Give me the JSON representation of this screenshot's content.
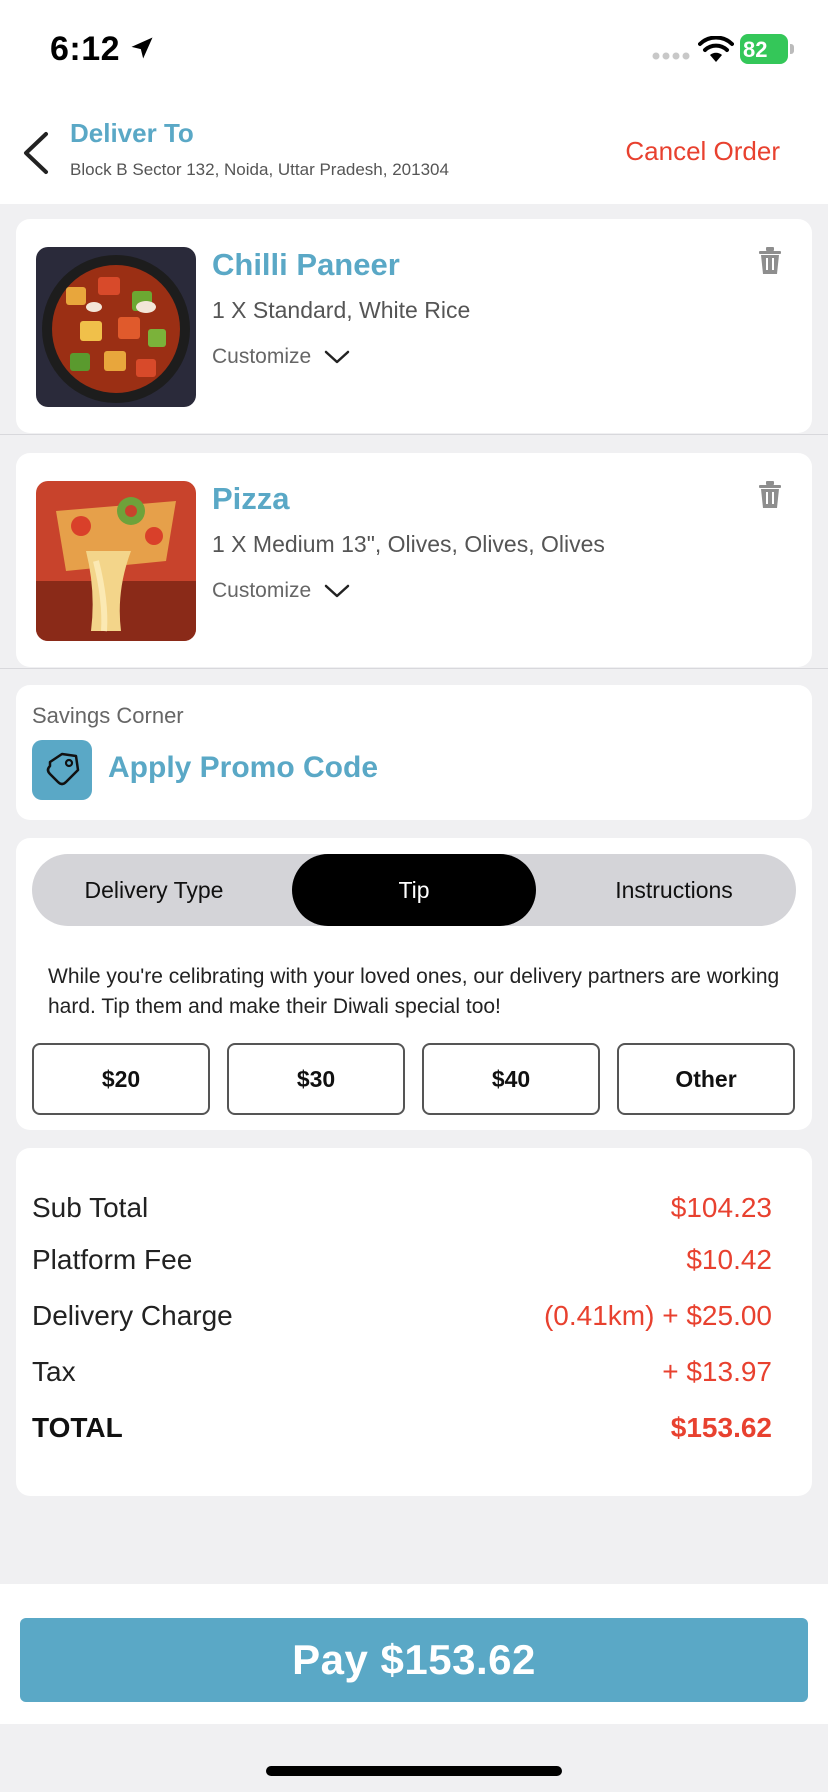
{
  "status_bar": {
    "time": "6:12",
    "battery": "82"
  },
  "header": {
    "title": "Deliver To",
    "address": "Block B Sector 132, Noida, Uttar Pradesh, 201304",
    "cancel_label": "Cancel Order"
  },
  "cart": {
    "items": [
      {
        "name": "Chilli Paneer",
        "details": "1 X Standard, White Rice",
        "customize_label": "Customize"
      },
      {
        "name": "Pizza",
        "details": "1 X Medium 13\", Olives, Olives, Olives",
        "customize_label": "Customize"
      }
    ]
  },
  "savings": {
    "label": "Savings Corner",
    "promo_label": "Apply Promo Code"
  },
  "tip": {
    "tabs": [
      "Delivery Type",
      "Tip",
      "Instructions"
    ],
    "selected_tab": "Tip",
    "message": "While you're celibrating with  your loved ones, our delivery partners are working hard. Tip them and make their Diwali special too!",
    "options": [
      "$20",
      "$30",
      "$40",
      "Other"
    ]
  },
  "summary": {
    "rows": [
      {
        "label": "Sub Total",
        "value": "$104.23"
      },
      {
        "label": "Platform Fee",
        "value": "$10.42"
      },
      {
        "label": "Delivery Charge",
        "value": "(0.41km) + $25.00"
      },
      {
        "label": "Tax",
        "value": "+ $13.97"
      }
    ],
    "total_label": "TOTAL",
    "total_value": "$153.62"
  },
  "pay_button_label": "Pay $153.62",
  "colors": {
    "accent": "#5aa8c6",
    "danger": "#e8412f",
    "battery": "#34c759"
  }
}
